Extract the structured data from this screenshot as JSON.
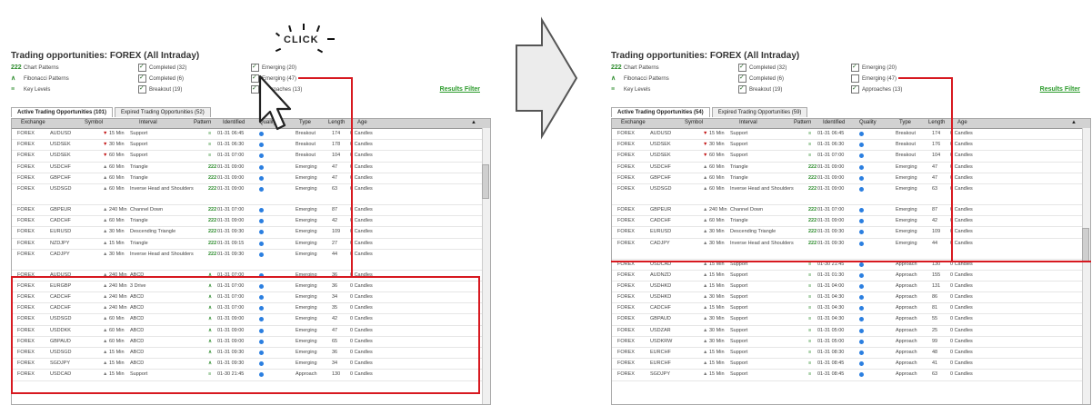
{
  "click_label": "CLICK",
  "cols": {
    "exchange": "Exchange",
    "symbol": "Symbol",
    "interval": "Interval",
    "pattern": "Pattern",
    "identified": "Identified",
    "quality": "Quality",
    "type": "Type",
    "length": "Length",
    "age": "Age"
  },
  "results_filter": "Results Filter",
  "left": {
    "title": "Trading opportunities: FOREX (All Intraday)",
    "filters": [
      {
        "label": "Chart Patterns",
        "icon": "222",
        "c1": "Completed (32)",
        "c1_on": true,
        "c2": "Emerging (20)",
        "c2_on": true
      },
      {
        "label": "Fibonacci Patterns",
        "icon": "∧",
        "c1": "Completed (6)",
        "c1_on": true,
        "c2": "Emerging (47)",
        "c2_on": true
      },
      {
        "label": "Key Levels",
        "icon": "≡",
        "c1": "Breakout (19)",
        "c1_on": true,
        "c2": "Approaches (13)",
        "c2_on": true
      }
    ],
    "tabs": [
      "Active Trading Opportunities (101)",
      "Expired Trading Opportunities (52)"
    ],
    "rows": [
      {
        "ex": "FOREX",
        "sym": "AUDUSD",
        "arr": "dn",
        "int": "15 Min",
        "pat": "Support",
        "pico": "≡",
        "id": "01-31 06:45",
        "q": 5,
        "type": "Breakout",
        "len": "174",
        "age": "0 Candles"
      },
      {
        "ex": "FOREX",
        "sym": "USDSEK",
        "arr": "dn",
        "int": "30 Min",
        "pat": "Support",
        "pico": "≡",
        "id": "01-31 06:30",
        "q": 6,
        "type": "Breakout",
        "len": "178",
        "age": "0 Candles"
      },
      {
        "ex": "FOREX",
        "sym": "USDSEK",
        "arr": "dn",
        "int": "60 Min",
        "pat": "Support",
        "pico": "≡",
        "id": "01-31 07:00",
        "q": 7,
        "type": "Breakout",
        "len": "104",
        "age": "0 Candles"
      },
      {
        "ex": "FOREX",
        "sym": "USDCHF",
        "arr": "up",
        "int": "60 Min",
        "pat": "Triangle",
        "pico": "222",
        "id": "01-31 09:00",
        "q": 5,
        "type": "Emerging",
        "len": "47",
        "age": "0 Candles"
      },
      {
        "ex": "FOREX",
        "sym": "GBPCHF",
        "arr": "up",
        "int": "60 Min",
        "pat": "Triangle",
        "pico": "222",
        "id": "01-31 09:00",
        "q": 5,
        "type": "Emerging",
        "len": "47",
        "age": "0 Candles"
      },
      {
        "ex": "FOREX",
        "sym": "USDSGD",
        "arr": "up",
        "int": "60 Min",
        "pat": "Inverse Head and Shoulders",
        "pico": "222",
        "id": "01-31 09:00",
        "q": 5,
        "type": "Emerging",
        "len": "63",
        "age": "0 Candles",
        "tall": true
      },
      {
        "ex": "FOREX",
        "sym": "GBPEUR",
        "arr": "up",
        "int": "240 Min",
        "pat": "Channel Down",
        "pico": "222",
        "id": "01-31 07:00",
        "q": 7,
        "type": "Emerging",
        "len": "87",
        "age": "0 Candles"
      },
      {
        "ex": "FOREX",
        "sym": "CADCHF",
        "arr": "up",
        "int": "60 Min",
        "pat": "Triangle",
        "pico": "222",
        "id": "01-31 09:00",
        "q": 5,
        "type": "Emerging",
        "len": "42",
        "age": "0 Candles"
      },
      {
        "ex": "FOREX",
        "sym": "EURUSD",
        "arr": "up",
        "int": "30 Min",
        "pat": "Descending Triangle",
        "pico": "222",
        "id": "01-31 09:30",
        "q": 5,
        "type": "Emerging",
        "len": "109",
        "age": "0 Candles"
      },
      {
        "ex": "FOREX",
        "sym": "NZDJPY",
        "arr": "up",
        "int": "15 Min",
        "pat": "Triangle",
        "pico": "222",
        "id": "01-31 09:15",
        "q": 5,
        "type": "Emerging",
        "len": "27",
        "age": "0 Candles"
      },
      {
        "ex": "FOREX",
        "sym": "CADJPY",
        "arr": "up",
        "int": "30 Min",
        "pat": "Inverse Head and Shoulders",
        "pico": "222",
        "id": "01-31 09:30",
        "q": 9,
        "type": "Emerging",
        "len": "44",
        "age": "0 Candles",
        "tall": true
      },
      {
        "ex": "FOREX",
        "sym": "AUDUSD",
        "arr": "up",
        "int": "240 Min",
        "pat": "ABCD",
        "pico": "∧",
        "id": "01-31 07:00",
        "q": 8,
        "type": "Emerging",
        "len": "36",
        "age": "0 Candles"
      },
      {
        "ex": "FOREX",
        "sym": "EURGBP",
        "arr": "up",
        "int": "240 Min",
        "pat": "3 Drive",
        "pico": "∧",
        "id": "01-31 07:00",
        "q": 8,
        "type": "Emerging",
        "len": "36",
        "age": "0 Candles"
      },
      {
        "ex": "FOREX",
        "sym": "CADCHF",
        "arr": "up",
        "int": "240 Min",
        "pat": "ABCD",
        "pico": "∧",
        "id": "01-31 07:00",
        "q": 8,
        "type": "Emerging",
        "len": "34",
        "age": "0 Candles"
      },
      {
        "ex": "FOREX",
        "sym": "CADCHF",
        "arr": "up",
        "int": "240 Min",
        "pat": "ABCD",
        "pico": "∧",
        "id": "01-31 07:00",
        "q": 8,
        "type": "Emerging",
        "len": "35",
        "age": "0 Candles"
      },
      {
        "ex": "FOREX",
        "sym": "USDSGD",
        "arr": "up",
        "int": "60 Min",
        "pat": "ABCD",
        "pico": "∧",
        "id": "01-31 09:00",
        "q": 8,
        "type": "Emerging",
        "len": "42",
        "age": "0 Candles"
      },
      {
        "ex": "FOREX",
        "sym": "USDDKK",
        "arr": "up",
        "int": "60 Min",
        "pat": "ABCD",
        "pico": "∧",
        "id": "01-31 09:00",
        "q": 8,
        "type": "Emerging",
        "len": "47",
        "age": "0 Candles"
      },
      {
        "ex": "FOREX",
        "sym": "GBPAUD",
        "arr": "up",
        "int": "60 Min",
        "pat": "ABCD",
        "pico": "∧",
        "id": "01-31 09:00",
        "q": 8,
        "type": "Emerging",
        "len": "65",
        "age": "0 Candles"
      },
      {
        "ex": "FOREX",
        "sym": "USDSGD",
        "arr": "up",
        "int": "15 Min",
        "pat": "ABCD",
        "pico": "∧",
        "id": "01-31 09:30",
        "q": 8,
        "type": "Emerging",
        "len": "36",
        "age": "0 Candles"
      },
      {
        "ex": "FOREX",
        "sym": "SGDJPY",
        "arr": "up",
        "int": "15 Min",
        "pat": "ABCD",
        "pico": "∧",
        "id": "01-31 09:30",
        "q": 8,
        "type": "Emerging",
        "len": "34",
        "age": "0 Candles"
      },
      {
        "ex": "FOREX",
        "sym": "USDCAD",
        "arr": "up",
        "int": "15 Min",
        "pat": "Support",
        "pico": "≡",
        "id": "01-30 21:45",
        "q": 5,
        "type": "Approach",
        "len": "130",
        "age": "0 Candles"
      }
    ]
  },
  "right": {
    "title": "Trading opportunities: FOREX (All Intraday)",
    "filters": [
      {
        "label": "Chart Patterns",
        "icon": "222",
        "c1": "Completed (32)",
        "c1_on": true,
        "c2": "Emerging (20)",
        "c2_on": true
      },
      {
        "label": "Fibonacci Patterns",
        "icon": "∧",
        "c1": "Completed (6)",
        "c1_on": true,
        "c2": "Emerging (47)",
        "c2_on": false
      },
      {
        "label": "Key Levels",
        "icon": "≡",
        "c1": "Breakout (19)",
        "c1_on": true,
        "c2": "Approaches (13)",
        "c2_on": true
      }
    ],
    "tabs": [
      "Active Trading Opportunities (54)",
      "Expired Trading Opportunities (59)"
    ],
    "rows": [
      {
        "ex": "FOREX",
        "sym": "AUDUSD",
        "arr": "dn",
        "int": "15 Min",
        "pat": "Support",
        "pico": "≡",
        "id": "01-31 06:45",
        "q": 5,
        "type": "Breakout",
        "len": "174",
        "age": "0 Candles"
      },
      {
        "ex": "FOREX",
        "sym": "USDSEK",
        "arr": "dn",
        "int": "30 Min",
        "pat": "Support",
        "pico": "≡",
        "id": "01-31 06:30",
        "q": 6,
        "type": "Breakout",
        "len": "176",
        "age": "0 Candles"
      },
      {
        "ex": "FOREX",
        "sym": "USDSEK",
        "arr": "dn",
        "int": "60 Min",
        "pat": "Support",
        "pico": "≡",
        "id": "01-31 07:00",
        "q": 7,
        "type": "Breakout",
        "len": "104",
        "age": "0 Candles"
      },
      {
        "ex": "FOREX",
        "sym": "USDCHF",
        "arr": "up",
        "int": "60 Min",
        "pat": "Triangle",
        "pico": "222",
        "id": "01-31 09:00",
        "q": 5,
        "type": "Emerging",
        "len": "47",
        "age": "0 Candles"
      },
      {
        "ex": "FOREX",
        "sym": "GBPCHF",
        "arr": "up",
        "int": "60 Min",
        "pat": "Triangle",
        "pico": "222",
        "id": "01-31 09:00",
        "q": 5,
        "type": "Emerging",
        "len": "47",
        "age": "0 Candles"
      },
      {
        "ex": "FOREX",
        "sym": "USDSGD",
        "arr": "up",
        "int": "60 Min",
        "pat": "Inverse Head and Shoulders",
        "pico": "222",
        "id": "01-31 09:00",
        "q": 5,
        "type": "Emerging",
        "len": "63",
        "age": "0 Candles",
        "tall": true
      },
      {
        "ex": "FOREX",
        "sym": "GBPEUR",
        "arr": "up",
        "int": "240 Min",
        "pat": "Channel Down",
        "pico": "222",
        "id": "01-31 07:00",
        "q": 7,
        "type": "Emerging",
        "len": "87",
        "age": "0 Candles"
      },
      {
        "ex": "FOREX",
        "sym": "CADCHF",
        "arr": "up",
        "int": "60 Min",
        "pat": "Triangle",
        "pico": "222",
        "id": "01-31 09:00",
        "q": 5,
        "type": "Emerging",
        "len": "42",
        "age": "0 Candles"
      },
      {
        "ex": "FOREX",
        "sym": "EURUSD",
        "arr": "up",
        "int": "30 Min",
        "pat": "Descending Triangle",
        "pico": "222",
        "id": "01-31 09:30",
        "q": 5,
        "type": "Emerging",
        "len": "109",
        "age": "0 Candles"
      },
      {
        "ex": "FOREX",
        "sym": "CADJPY",
        "arr": "up",
        "int": "30 Min",
        "pat": "Inverse Head and Shoulders",
        "pico": "222",
        "id": "01-31 09:30",
        "q": 9,
        "type": "Emerging",
        "len": "44",
        "age": "0 Candles",
        "tall": true
      },
      {
        "ex": "FOREX",
        "sym": "USDCAD",
        "arr": "up",
        "int": "15 Min",
        "pat": "Support",
        "pico": "≡",
        "id": "01-30 21:45",
        "q": 5,
        "type": "Approach",
        "len": "130",
        "age": "0 Candles"
      },
      {
        "ex": "FOREX",
        "sym": "AUDNZD",
        "arr": "up",
        "int": "15 Min",
        "pat": "Support",
        "pico": "≡",
        "id": "01-31 01:30",
        "q": 5,
        "type": "Approach",
        "len": "155",
        "age": "0 Candles"
      },
      {
        "ex": "FOREX",
        "sym": "USDHKD",
        "arr": "up",
        "int": "15 Min",
        "pat": "Support",
        "pico": "≡",
        "id": "01-31 04:00",
        "q": 4,
        "type": "Approach",
        "len": "131",
        "age": "0 Candles"
      },
      {
        "ex": "FOREX",
        "sym": "USDHKD",
        "arr": "up",
        "int": "30 Min",
        "pat": "Support",
        "pico": "≡",
        "id": "01-31 04:30",
        "q": 4,
        "type": "Approach",
        "len": "86",
        "age": "0 Candles"
      },
      {
        "ex": "FOREX",
        "sym": "CADCHF",
        "arr": "up",
        "int": "15 Min",
        "pat": "Support",
        "pico": "≡",
        "id": "01-31 04:30",
        "q": 3,
        "type": "Approach",
        "len": "81",
        "age": "0 Candles"
      },
      {
        "ex": "FOREX",
        "sym": "GBPAUD",
        "arr": "up",
        "int": "30 Min",
        "pat": "Support",
        "pico": "≡",
        "id": "01-31 04:30",
        "q": 3,
        "type": "Approach",
        "len": "55",
        "age": "0 Candles"
      },
      {
        "ex": "FOREX",
        "sym": "USDZAR",
        "arr": "up",
        "int": "30 Min",
        "pat": "Support",
        "pico": "≡",
        "id": "01-31 05:00",
        "q": 3,
        "type": "Approach",
        "len": "25",
        "age": "0 Candles"
      },
      {
        "ex": "FOREX",
        "sym": "USDKRW",
        "arr": "up",
        "int": "30 Min",
        "pat": "Support",
        "pico": "≡",
        "id": "01-31 05:00",
        "q": 3,
        "type": "Approach",
        "len": "99",
        "age": "0 Candles"
      },
      {
        "ex": "FOREX",
        "sym": "EURCHF",
        "arr": "up",
        "int": "15 Min",
        "pat": "Support",
        "pico": "≡",
        "id": "01-31 08:30",
        "q": 3,
        "type": "Approach",
        "len": "48",
        "age": "0 Candles"
      },
      {
        "ex": "FOREX",
        "sym": "EURCHF",
        "arr": "up",
        "int": "15 Min",
        "pat": "Support",
        "pico": "≡",
        "id": "01-31 08:45",
        "q": 3,
        "type": "Approach",
        "len": "41",
        "age": "0 Candles"
      },
      {
        "ex": "FOREX",
        "sym": "SGDJPY",
        "arr": "up",
        "int": "15 Min",
        "pat": "Support",
        "pico": "≡",
        "id": "01-31 08:45",
        "q": 3,
        "type": "Approach",
        "len": "63",
        "age": "0 Candles"
      }
    ]
  }
}
